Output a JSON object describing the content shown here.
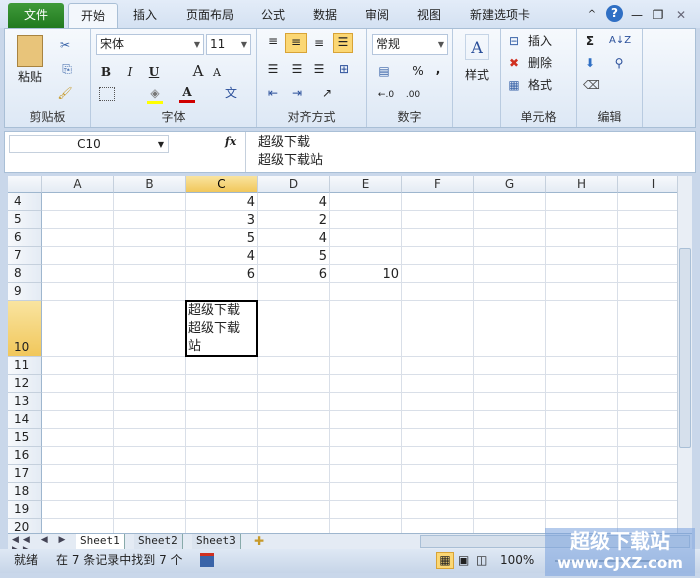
{
  "tabs": [
    "文件",
    "开始",
    "插入",
    "页面布局",
    "公式",
    "数据",
    "审阅",
    "视图",
    "新建选项卡"
  ],
  "window_controls": {
    "minimize_ribbon": "^",
    "help": "?",
    "minimize": "—",
    "restore": "❐",
    "close": "✕"
  },
  "ribbon": {
    "clipboard": {
      "label": "剪贴板",
      "paste": "粘贴"
    },
    "font": {
      "label": "字体",
      "name": "宋体",
      "size": "11",
      "bold": "B",
      "italic": "I",
      "underline": "U",
      "grow": "A",
      "shrink": "A",
      "font_color": "A",
      "phonetic": "文"
    },
    "alignment": {
      "label": "对齐方式"
    },
    "number": {
      "label": "数字",
      "format": "常规",
      "percent": "%",
      "comma": ",",
      "inc_decimal": "←.0",
      "dec_decimal": ".00"
    },
    "styles": {
      "label": "样式"
    },
    "cells": {
      "label": "单元格",
      "insert": "插入",
      "delete": "删除",
      "format": "格式"
    },
    "editing": {
      "label": "编辑",
      "sum": "Σ"
    }
  },
  "formula_bar": {
    "name_box": "C10",
    "fx": "fx",
    "content_line1": "超级下载",
    "content_line2": "超级下载站"
  },
  "columns": [
    "A",
    "B",
    "C",
    "D",
    "E",
    "F",
    "G",
    "H",
    "I"
  ],
  "selected_column": "C",
  "rows": [
    "4",
    "5",
    "6",
    "7",
    "8",
    "9",
    "10",
    "11",
    "12",
    "13",
    "14",
    "15",
    "16",
    "17",
    "18",
    "19",
    "20"
  ],
  "selected_row": "10",
  "cells": [
    {
      "ref": "C4",
      "v": "4"
    },
    {
      "ref": "D4",
      "v": "4"
    },
    {
      "ref": "C5",
      "v": "3"
    },
    {
      "ref": "D5",
      "v": "2"
    },
    {
      "ref": "C6",
      "v": "5"
    },
    {
      "ref": "D6",
      "v": "4"
    },
    {
      "ref": "C7",
      "v": "4"
    },
    {
      "ref": "D7",
      "v": "5"
    },
    {
      "ref": "C8",
      "v": "6"
    },
    {
      "ref": "D8",
      "v": "6"
    },
    {
      "ref": "E8",
      "v": "10"
    }
  ],
  "active_cell": {
    "ref": "C10",
    "lines": [
      "超级下载",
      "超级下载",
      "站"
    ]
  },
  "sheets": [
    "Sheet1",
    "Sheet2",
    "Sheet3"
  ],
  "active_sheet": "Sheet1",
  "status": {
    "ready": "就绪",
    "find_result": "在 7 条记录中找到 7 个",
    "zoom": "100%"
  },
  "watermark": {
    "line1": "超级下载站",
    "line2": "www.CJXZ.com"
  }
}
